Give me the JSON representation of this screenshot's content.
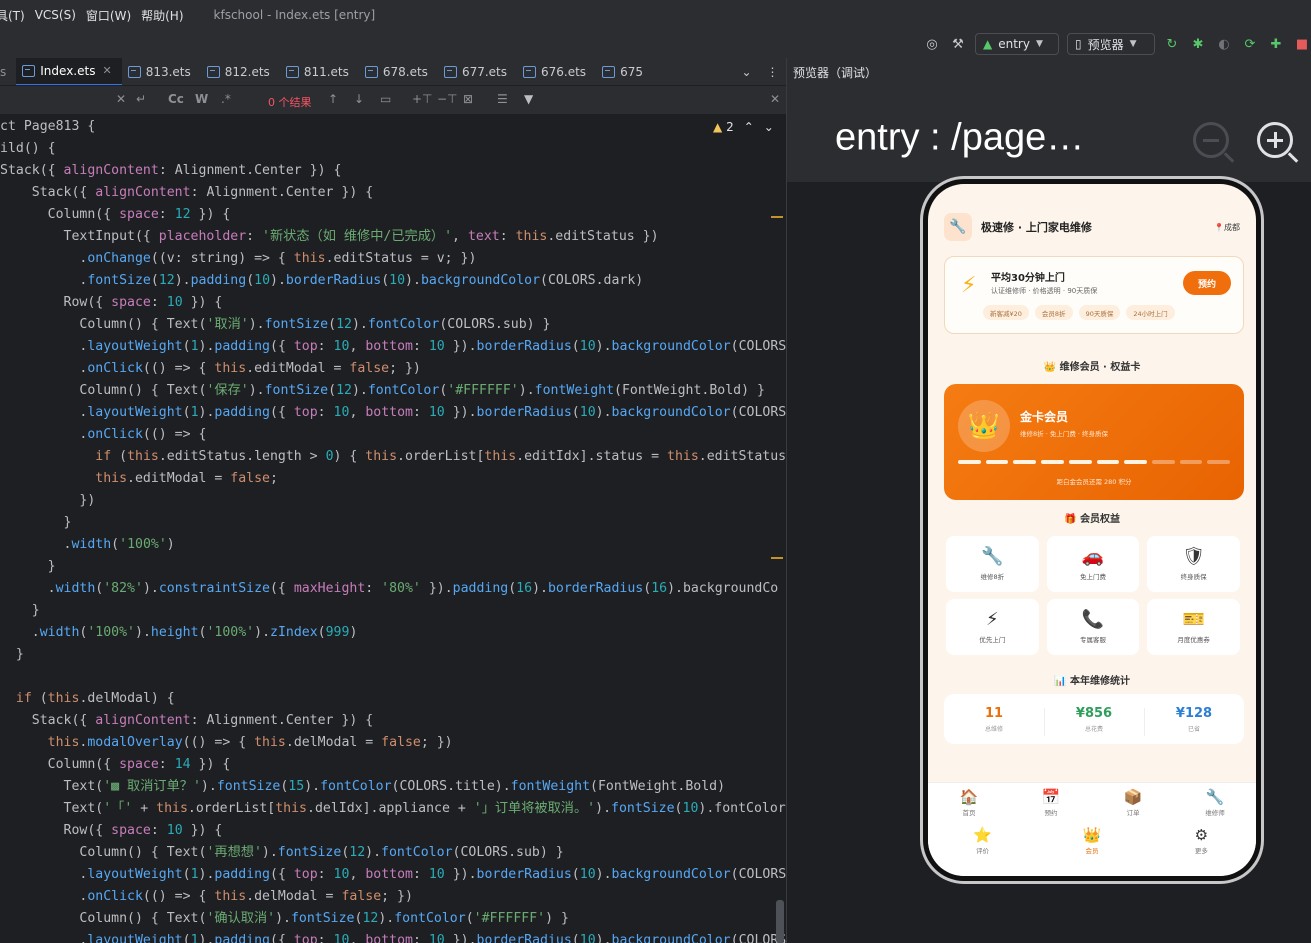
{
  "menubar": {
    "items": [
      "具(T)",
      "VCS(S)",
      "窗口(W)",
      "帮助(H)"
    ],
    "window_title": "kfschool - Index.ets [entry]"
  },
  "toolbar": {
    "module": "entry",
    "previewer": "预览器"
  },
  "editor_tabs": [
    "Index.ets",
    "813.ets",
    "812.ets",
    "811.ets",
    "678.ets",
    "677.ets",
    "676.ets",
    "675"
  ],
  "findbar": {
    "case_label": "Cc",
    "word_label": "W",
    "regex_label": ".*",
    "results": "0 个结果"
  },
  "warnings": {
    "count": "2"
  },
  "code": [
    "ct Page813 {",
    "ild() {",
    "Stack({ alignContent: Alignment.Center }) {",
    "    Stack({ alignContent: Alignment.Center }) {",
    "      Column({ space: 12 }) {",
    "        TextInput({ placeholder: '新状态（如 维修中/已完成）', text: this.editStatus })",
    "          .onChange((v: string) => { this.editStatus = v; })",
    "          .fontSize(12).padding(10).borderRadius(10).backgroundColor(COLORS.dark)",
    "        Row({ space: 10 }) {",
    "          Column() { Text('取消').fontSize(12).fontColor(COLORS.sub) }",
    "          .layoutWeight(1).padding({ top: 10, bottom: 10 }).borderRadius(10).backgroundColor(COLORS",
    "          .onClick(() => { this.editModal = false; })",
    "          Column() { Text('保存').fontSize(12).fontColor('#FFFFFF').fontWeight(FontWeight.Bold) }",
    "          .layoutWeight(1).padding({ top: 10, bottom: 10 }).borderRadius(10).backgroundColor(COLORS",
    "          .onClick(() => {",
    "            if (this.editStatus.length > 0) { this.orderList[this.editIdx].status = this.editStatus",
    "            this.editModal = false;",
    "          })",
    "        }",
    "        .width('100%')",
    "      }",
    "      .width('82%').constraintSize({ maxHeight: '80%' }).padding(16).borderRadius(16).backgroundCo",
    "    }",
    "    .width('100%').height('100%').zIndex(999)",
    "  }",
    "",
    "  if (this.delModal) {",
    "    Stack({ alignContent: Alignment.Center }) {",
    "      this.modalOverlay(() => { this.delModal = false; })",
    "      Column({ space: 14 }) {",
    "        Text('▩ 取消订单？').fontSize(15).fontColor(COLORS.title).fontWeight(FontWeight.Bold)",
    "        Text('「' + this.orderList[this.delIdx].appliance + '」订单将被取消。').fontSize(10).fontColor",
    "        Row({ space: 10 }) {",
    "          Column() { Text('再想想').fontSize(12).fontColor(COLORS.sub) }",
    "          .layoutWeight(1).padding({ top: 10, bottom: 10 }).borderRadius(10).backgroundColor(COLORS",
    "          .onClick(() => { this.delModal = false; })",
    "          Column() { Text('确认取消').fontSize(12).fontColor('#FFFFFF') }",
    "          .layoutWeight(1).padding({ top: 10, bottom: 10 }).borderRadius(10).backgroundColor(COLORS"
  ],
  "preview": {
    "panel_label": "预览器（调试）",
    "title": "entry : /page…"
  },
  "app": {
    "title": "极速修 · 上门家电维修",
    "city": "成都",
    "promo": {
      "title": "平均30分钟上门",
      "subtitle": "认证维修师 · 价格透明 · 90天质保",
      "button": "预约",
      "tags": [
        "新客减¥20",
        "会员8折",
        "90天质保",
        "24小时上门"
      ]
    },
    "member_section": "维修会员 · 权益卡",
    "gold_card": {
      "title": "金卡会员",
      "subtitle": "维修8折 · 免上门费 · 终身质保",
      "progress_filled": 7,
      "progress_total": 10,
      "note": "距白金会员还需 280 积分"
    },
    "benefits_section": "会员权益",
    "benefits": [
      {
        "icon": "wrench-icon",
        "label": "维修8折"
      },
      {
        "icon": "car-icon",
        "label": "免上门费"
      },
      {
        "icon": "shield-icon",
        "label": "终身质保"
      },
      {
        "icon": "bolt-icon",
        "label": "优先上门"
      },
      {
        "icon": "phone-icon",
        "label": "专属客服"
      },
      {
        "icon": "ticket-icon",
        "label": "月度优惠券"
      }
    ],
    "stats_section": "本年维修统计",
    "stats": [
      {
        "value": "11",
        "label": "总维修",
        "color": "#e8700e"
      },
      {
        "value": "¥856",
        "label": "总花费",
        "color": "#2f9e5b"
      },
      {
        "value": "¥128",
        "label": "已省",
        "color": "#2d7fd3"
      }
    ],
    "nav": [
      {
        "icon": "home-icon",
        "label": "首页"
      },
      {
        "icon": "calendar-icon",
        "label": "预约"
      },
      {
        "icon": "box-icon",
        "label": "订单"
      },
      {
        "icon": "wrench-icon",
        "label": "维修师"
      },
      {
        "icon": "star-icon",
        "label": "评价"
      },
      {
        "icon": "crown-icon",
        "label": "会员"
      },
      {
        "icon": "gear-icon",
        "label": "更多"
      }
    ],
    "active_nav": "会员"
  }
}
